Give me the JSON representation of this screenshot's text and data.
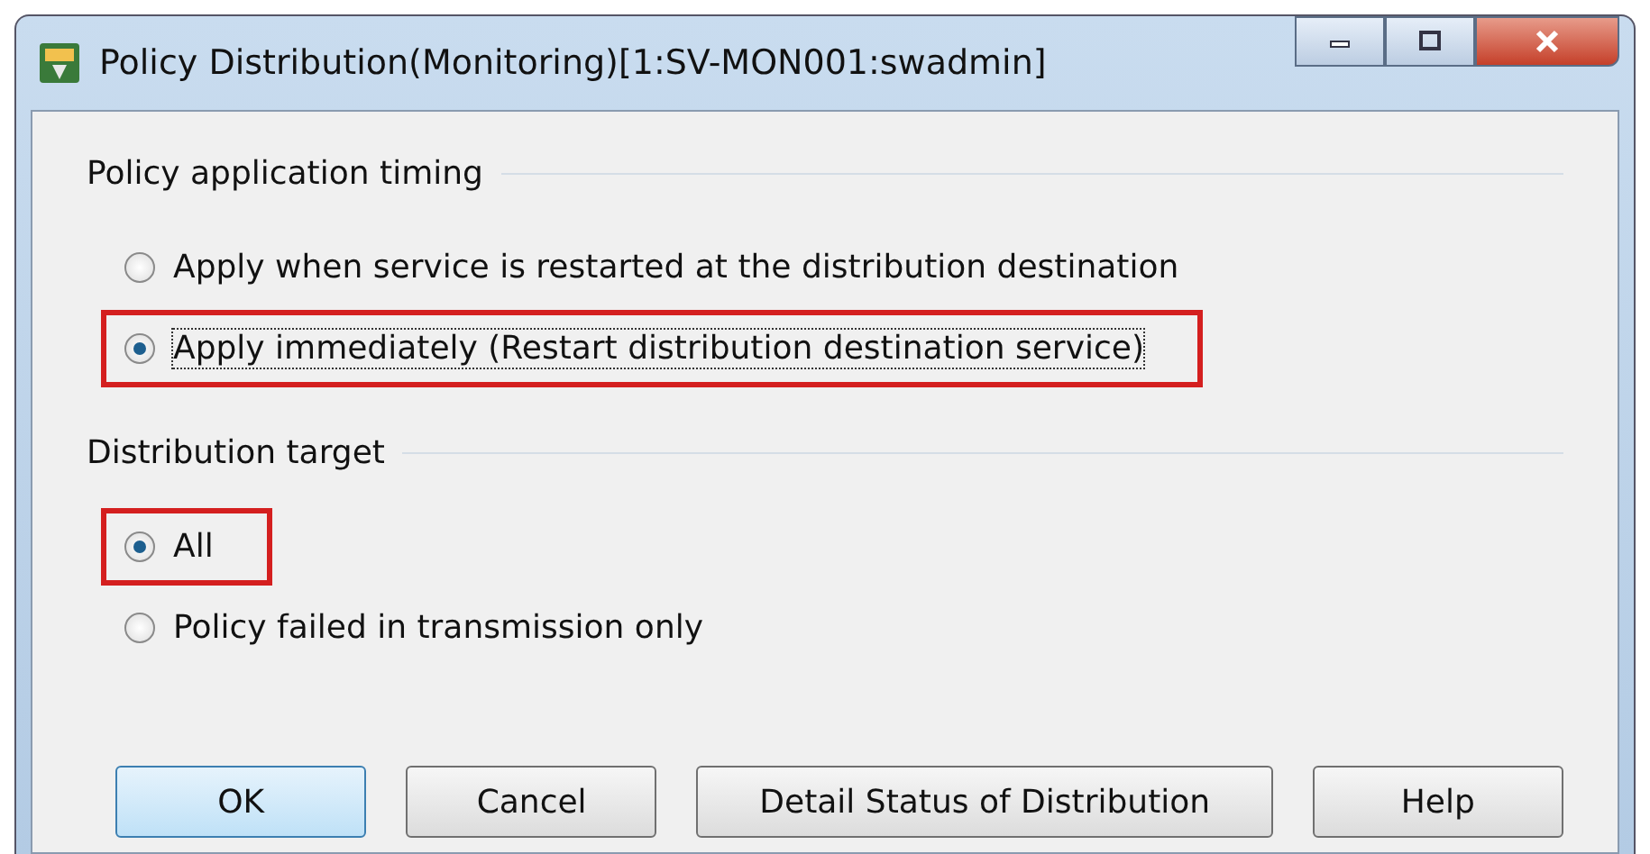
{
  "window": {
    "title": "Policy Distribution(Monitoring)[1:SV-MON001:swadmin]"
  },
  "groups": [
    {
      "title": "Policy application timing",
      "options": [
        {
          "label": "Apply when service is restarted at the distribution destination",
          "selected": false,
          "highlighted": false
        },
        {
          "label": "Apply immediately (Restart distribution destination service)",
          "selected": true,
          "highlighted": true
        }
      ]
    },
    {
      "title": "Distribution target",
      "options": [
        {
          "label": "All",
          "selected": true,
          "highlighted": true
        },
        {
          "label": "Policy failed in transmission only",
          "selected": false,
          "highlighted": false
        }
      ]
    }
  ],
  "buttons": [
    {
      "label": "OK",
      "default": true
    },
    {
      "label": "Cancel",
      "default": false
    },
    {
      "label": "Detail Status of Distribution",
      "default": false
    },
    {
      "label": "Help",
      "default": false
    }
  ]
}
